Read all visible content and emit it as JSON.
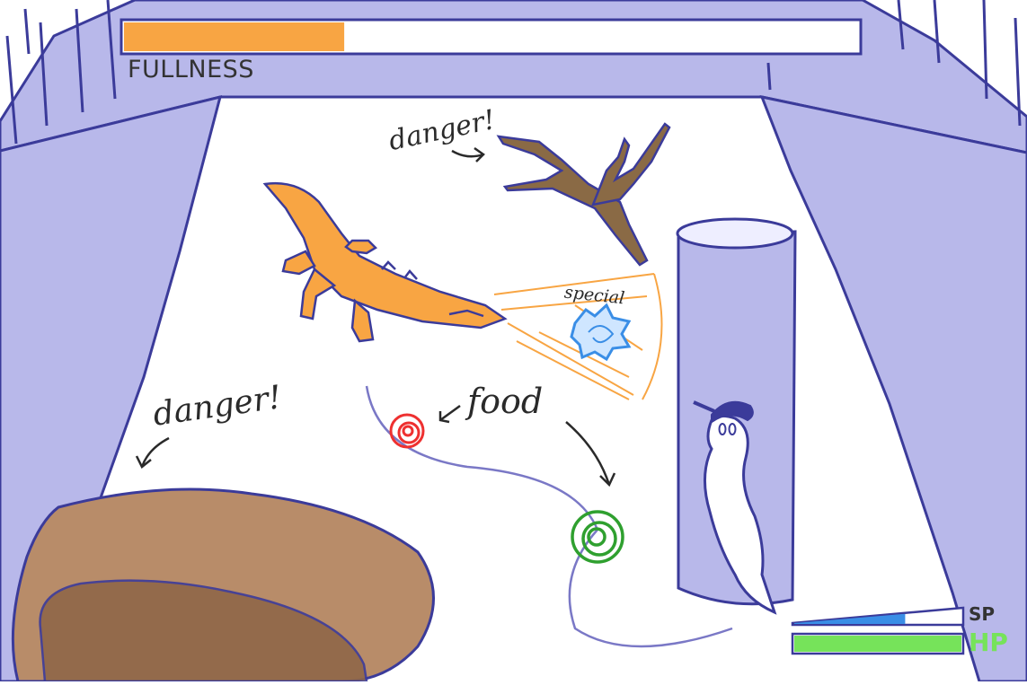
{
  "hud": {
    "fullness": {
      "label": "FULLNESS",
      "value": 0.3,
      "fill_color": "#f8a543"
    },
    "sp": {
      "label": "SP",
      "value": 0.66,
      "fill_color": "#3a8ee6"
    },
    "hp": {
      "label": "HP",
      "value": 1.0,
      "fill_color": "#76e35a"
    }
  },
  "annotations": {
    "danger_top": "danger!",
    "danger_left": "danger!",
    "food": "food",
    "special": "special"
  },
  "colors": {
    "wall": "#b8b8ea",
    "outline": "#3b3b9a",
    "floor": "#ffffff",
    "rock": "#b88c69",
    "branch": "#8a6a45",
    "lizard": "#f8a543",
    "food_red": "#ee3030",
    "food_green": "#2fa02f",
    "special_item": "#3a8ee6"
  },
  "icons": {
    "player": "ghost-with-cap-icon",
    "enemy": "orange-lizard-icon",
    "special_item": "blue-crystal-icon"
  }
}
